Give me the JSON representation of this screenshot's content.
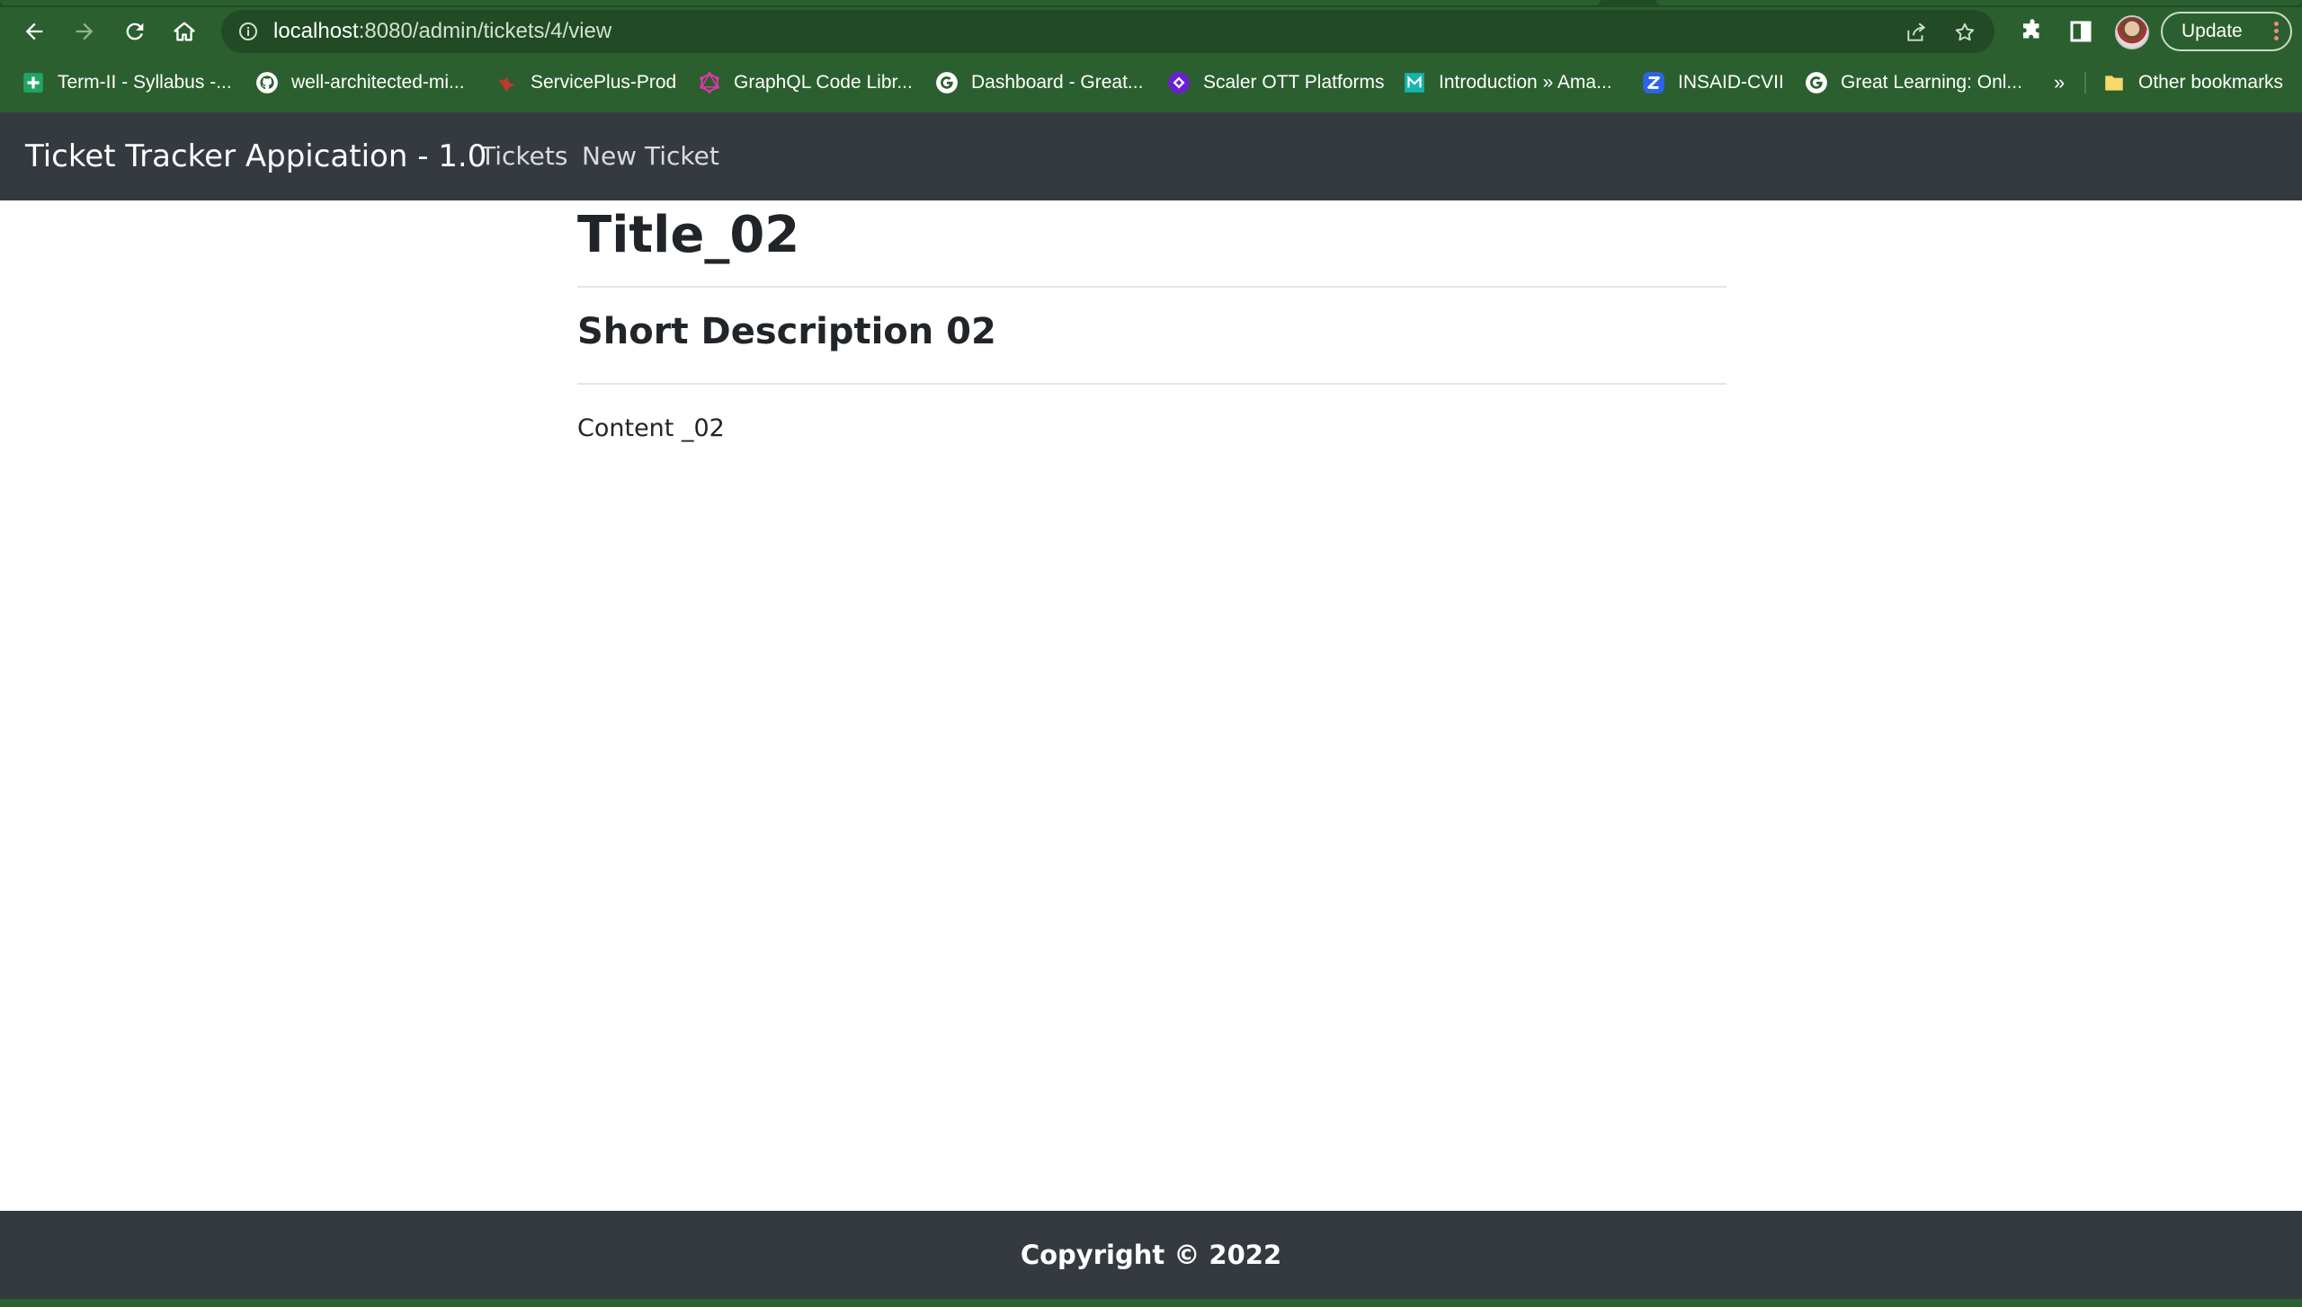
{
  "browser": {
    "url_host": "localhost",
    "url_rest": ":8080/admin/tickets/4/view",
    "update_label": "Update",
    "colors": {
      "frame": "#2b5f2f",
      "omnibox": "#214a25"
    },
    "bookmarks": [
      {
        "label": "Term-II - Syllabus -...",
        "icon": "sheets-plus-icon"
      },
      {
        "label": "well-architected-mi...",
        "icon": "github-icon"
      },
      {
        "label": "ServicePlus-Prod",
        "icon": "serviceplus-icon"
      },
      {
        "label": "GraphQL Code Libr...",
        "icon": "graphql-icon"
      },
      {
        "label": "Dashboard - Great...",
        "icon": "google-g-icon"
      },
      {
        "label": "Scaler OTT Platforms",
        "icon": "scaler-icon"
      },
      {
        "label": "Introduction » Ama...",
        "icon": "teal-bookmark-icon"
      },
      {
        "label": "INSAID-CVII",
        "icon": "zoom-z-icon"
      },
      {
        "label": "Great Learning: Onl...",
        "icon": "google-g-icon"
      }
    ],
    "more_bookmarks": "»",
    "other_bookmarks": "Other bookmarks"
  },
  "app": {
    "brand": "Ticket Tracker Appication - 1.0",
    "nav": {
      "tickets": "Tickets",
      "new_ticket": "New Ticket"
    },
    "colors": {
      "navbar": "#343a40",
      "text": "#212529"
    }
  },
  "ticket": {
    "title": "Title_02",
    "short_description": "Short Description 02",
    "content": "Content _02"
  },
  "footer": {
    "copyright": "Copyright © 2022"
  }
}
